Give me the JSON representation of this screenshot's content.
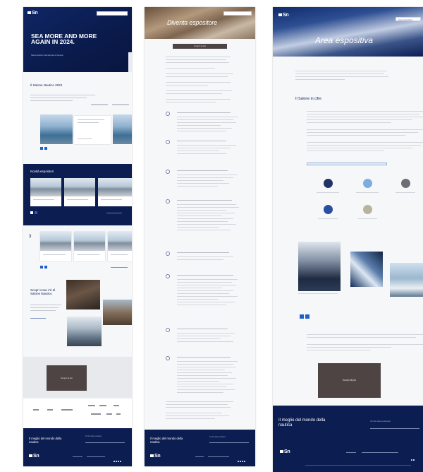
{
  "col1": {
    "hero_title": "SEA MORE AND MORE AGAIN IN 2024.",
    "hero_subtitle": "Salone Nautico Internazionale di Genova",
    "section1_title": "Il Salone Nautico 2024",
    "section2_title": "Novità espositori",
    "section4_title": "Scopri cosa c'è al Salone Nautico",
    "cta_label": "Scopri di più",
    "footer_claim": "Il meglio del mondo della nautica",
    "newsletter_label": "Iscriviti alla newsletter"
  },
  "col2": {
    "hero_title": "Diventa espositore",
    "cta_label": "Scopri di più",
    "footer_claim": "Il meglio del mondo della nautica",
    "newsletter_label": "Iscriviti alla newsletter"
  },
  "col3": {
    "hero_title": "Area espositiva",
    "lang_label": "Area espositori",
    "section_title": "Il Salone in cifre",
    "cta_label": "Scopri di più",
    "footer_claim": "Il meglio del mondo della nautica",
    "newsletter_label": "Iscriviti alla newsletter",
    "circle_colors": [
      "#22336b",
      "#7aaee0",
      "#6b6f75",
      "#2a4fa0",
      "#b8b49a"
    ]
  },
  "colors": {
    "navy": "#0c1d52",
    "accent_blue": "#1f5fc9",
    "cta_brown": "#4d4443"
  },
  "icons": [
    "logo-icon",
    "search-icon",
    "chevron-down-icon",
    "social-icon"
  ]
}
